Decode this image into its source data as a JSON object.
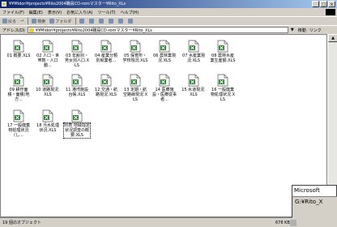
{
  "window": {
    "title": "¥¥Midori¥projects¥Rito2004職員CD-romマスター¥Rito_XLs",
    "buttons": [
      "_",
      "□",
      "×"
    ]
  },
  "menu": [
    "ファイル(F)",
    "編集(E)",
    "表示(V)",
    "お気に入り(A)",
    "ツール(T)",
    "ヘルプ(H)"
  ],
  "toolbar": {
    "back": "戻る",
    "forward": "→",
    "search": "検索",
    "folders": "フォルダ"
  },
  "address": {
    "label": "アドレス(D)",
    "value": "¥¥Midori¥projects¥Rito2004職員CD-romマスター¥Rito_XLs",
    "go": "移動",
    "links": "リンク"
  },
  "files": [
    "01 概要.XLS",
    "02 人口・世帯数・人口動...",
    "03 年齢別・男女別人口.XLS",
    "04 産業分類別就業者...",
    "05 保育所・学校現況.XLS",
    "06 農林業現況.XLS",
    "07 水産業現況.XLS",
    "08 農林水産業生産額.XLS",
    "09 耕作面積・面積(地方...",
    "10 道路現況.XLS",
    "11 港湾施設台帳.XLS",
    "12 交通・航路現況.XLS",
    "13 定期・航空路線現況.XLS",
    "14 医療施設・医療従事者...",
    "15 水道現況.XLS",
    "16 一般廃棄物処理状況.XLS",
    "17 一般廃棄物処理状況(し...",
    "18 汚水処理状況.XLS",
    "附表 地域指定状況調査の概要.XLS"
  ],
  "status": {
    "left": "19 個のオブジェクト",
    "size": "678 KB"
  },
  "popup": {
    "title": "Microsoft",
    "text": "G:¥Rito_X"
  }
}
